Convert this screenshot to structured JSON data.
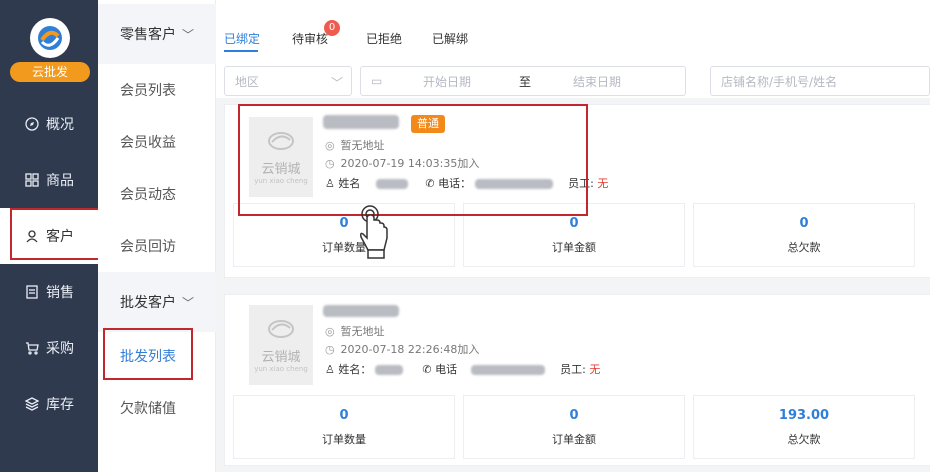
{
  "rail": {
    "badge": "云批发",
    "items": [
      {
        "label": "概况"
      },
      {
        "label": "商品"
      },
      {
        "label": "客户"
      },
      {
        "label": "销售"
      },
      {
        "label": "采购"
      },
      {
        "label": "库存"
      }
    ]
  },
  "subnav": {
    "group1": "零售客户",
    "group1_items": [
      "会员列表",
      "会员收益",
      "会员动态",
      "会员回访"
    ],
    "group2": "批发客户",
    "group2_items": [
      "批发列表",
      "欠款储值"
    ]
  },
  "tabs": [
    {
      "label": "已绑定"
    },
    {
      "label": "待审核",
      "badge": "0"
    },
    {
      "label": "已拒绝"
    },
    {
      "label": "已解绑"
    }
  ],
  "filters": {
    "region_placeholder": "地区",
    "start_placeholder": "开始日期",
    "to": "至",
    "end_placeholder": "结束日期",
    "search_placeholder": "店铺名称/手机号/姓名"
  },
  "cards": [
    {
      "tag": "普通",
      "address": "暂无地址",
      "added": "2020-07-19 14:03:35加入",
      "name_label": "姓名",
      "phone_label": "电话：",
      "staff_label": "员工:",
      "staff_value": "无",
      "stats": [
        {
          "value": "0",
          "label": "订单数量"
        },
        {
          "value": "0",
          "label": "订单金额"
        },
        {
          "value": "0",
          "label": "总欠款"
        }
      ]
    },
    {
      "tag": "",
      "address": "暂无地址",
      "added": "2020-07-18 22:26:48加入",
      "name_label": "姓名：",
      "phone_label": "电话",
      "staff_label": "员工:",
      "staff_value": "无",
      "stats": [
        {
          "value": "0",
          "label": "订单数量"
        },
        {
          "value": "0",
          "label": "订单金额"
        },
        {
          "value": "193.00",
          "label": "总欠款"
        }
      ]
    }
  ],
  "thumb": {
    "line1": "云销城",
    "line2": "yun xiao cheng"
  }
}
